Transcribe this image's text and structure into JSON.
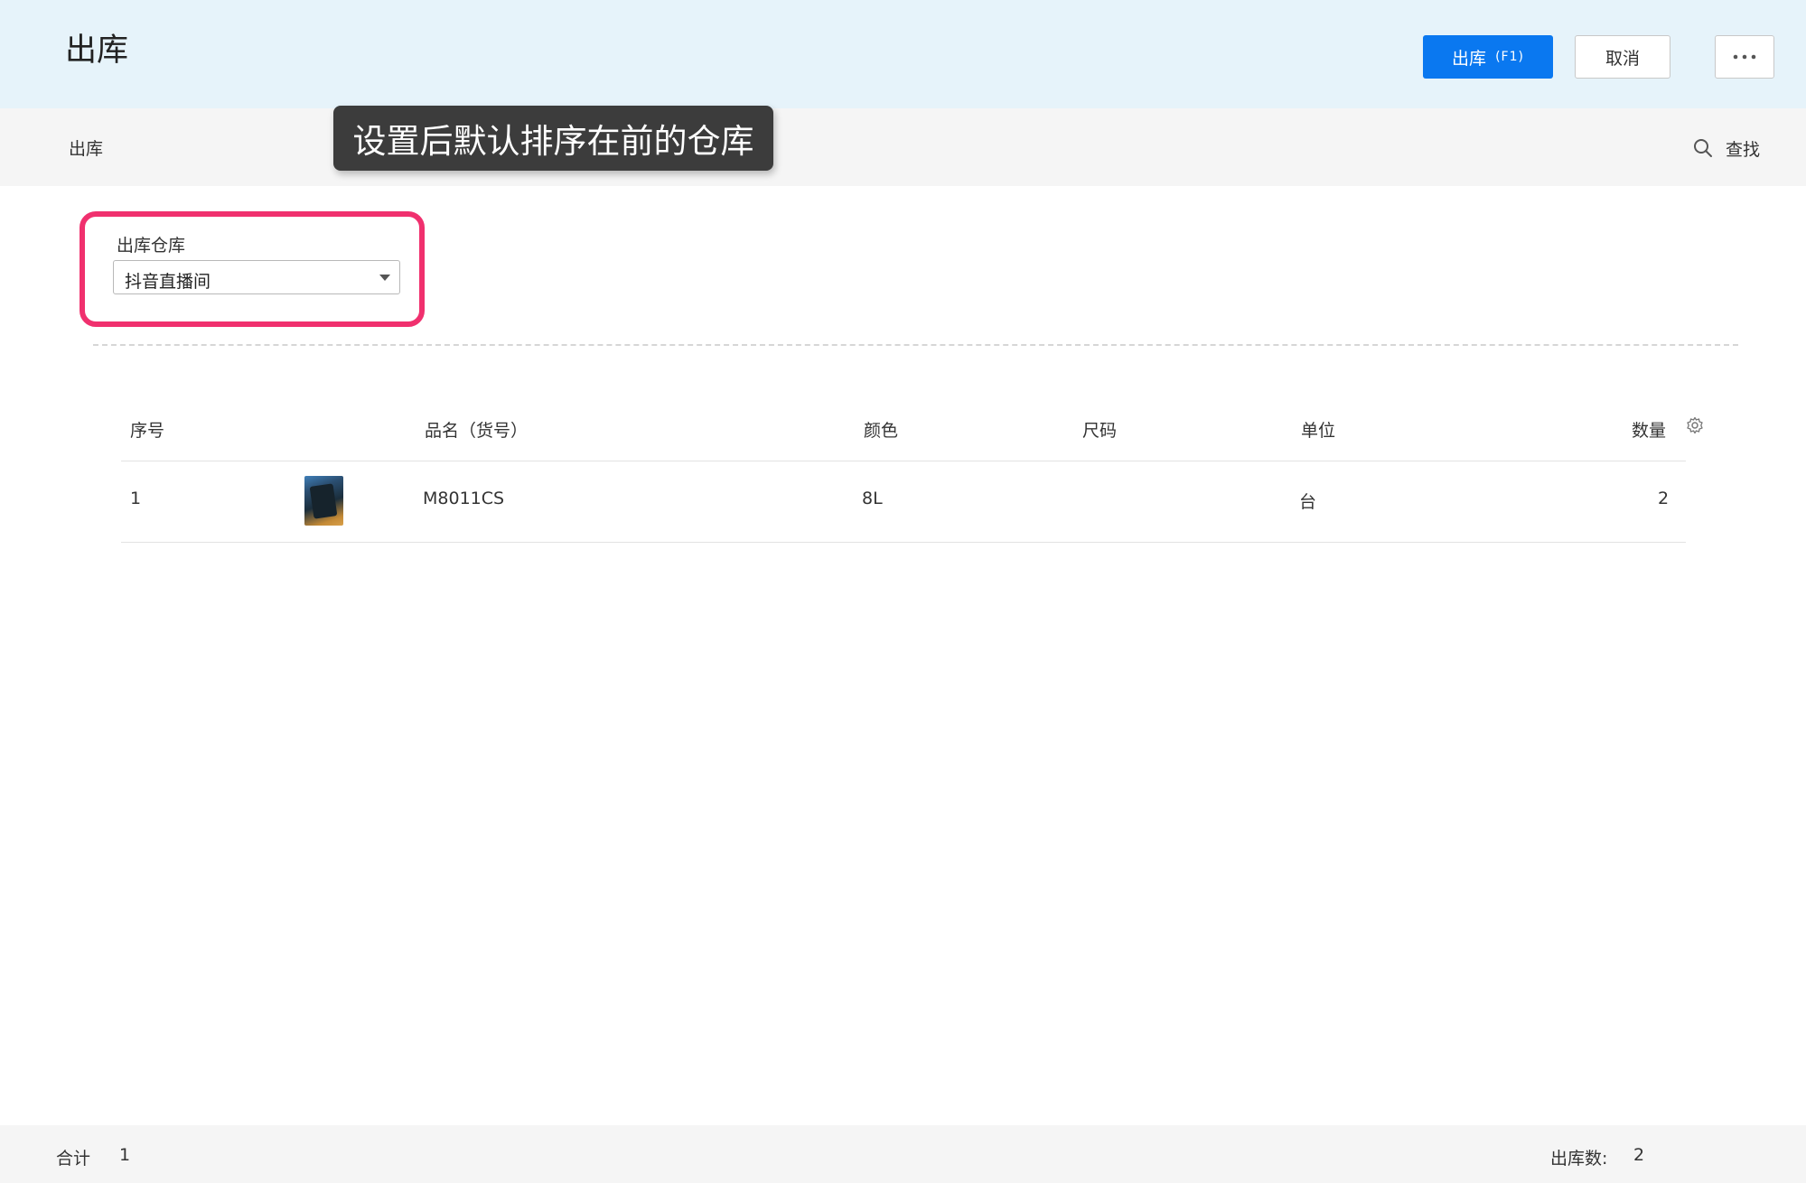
{
  "header": {
    "title": "出库",
    "primary_button": {
      "label": "出库",
      "hotkey": "(F1)"
    },
    "cancel_button": {
      "label": "取消"
    },
    "more_button": {
      "icon": "more-horizontal-icon"
    }
  },
  "subbar": {
    "title": "出库",
    "find": {
      "label": "查找",
      "icon": "search-icon"
    }
  },
  "tooltip": {
    "text": "设置后默认排序在前的仓库"
  },
  "warehouse_field": {
    "label": "出库仓库",
    "value": "抖音直播间",
    "highlight_color": "#f0306e"
  },
  "table": {
    "columns": [
      "序号",
      "品名（货号）",
      "颜色",
      "尺码",
      "单位",
      "数量"
    ],
    "settings_icon": "gear-icon",
    "rows": [
      {
        "index": "1",
        "name": "M8011CS",
        "color": "8L",
        "size": "",
        "unit": "台",
        "quantity": "2"
      }
    ]
  },
  "footer": {
    "total_label": "合计",
    "total_value": "1",
    "outbound_label": "出库数:",
    "outbound_value": "2"
  },
  "colors": {
    "header_bg": "#e6f3fa",
    "primary": "#0a78f0",
    "tooltip_bg": "#3c3c3c"
  }
}
